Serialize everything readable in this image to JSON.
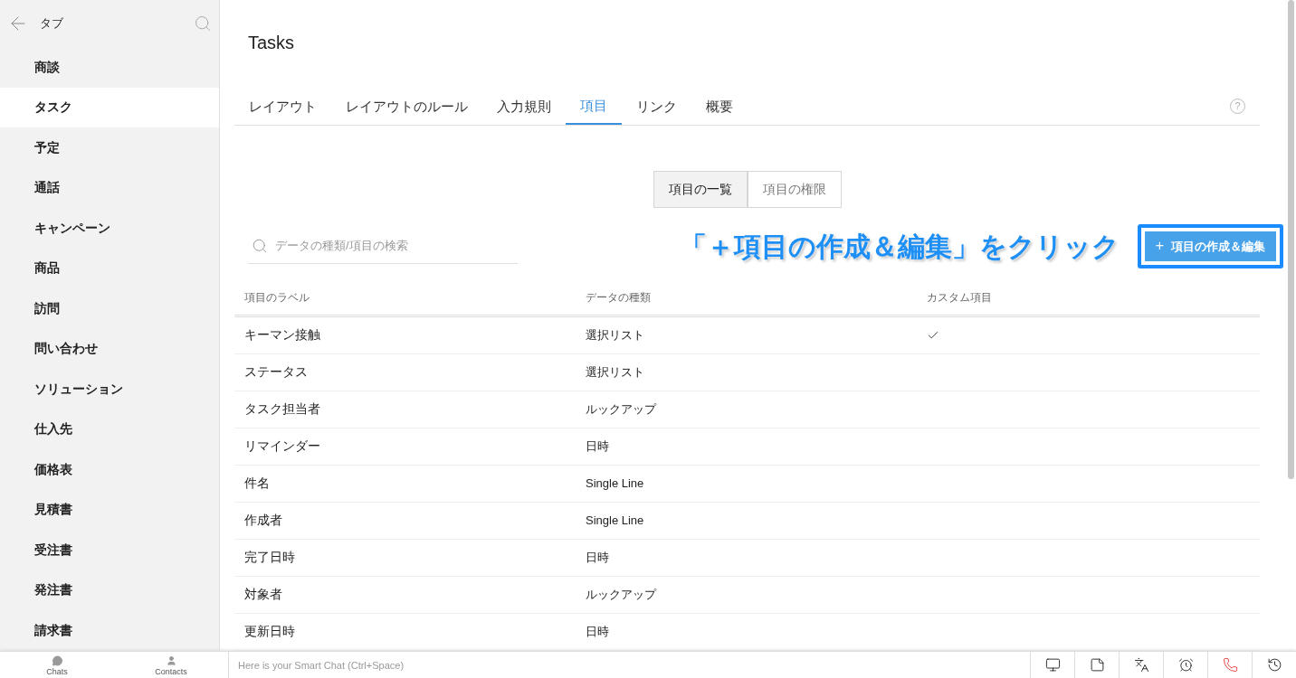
{
  "sidebar": {
    "title": "タブ",
    "items": [
      {
        "label": "商談",
        "selected": false
      },
      {
        "label": "タスク",
        "selected": true
      },
      {
        "label": "予定",
        "selected": false
      },
      {
        "label": "通話",
        "selected": false
      },
      {
        "label": "キャンペーン",
        "selected": false
      },
      {
        "label": "商品",
        "selected": false
      },
      {
        "label": "訪問",
        "selected": false
      },
      {
        "label": "問い合わせ",
        "selected": false
      },
      {
        "label": "ソリューション",
        "selected": false
      },
      {
        "label": "仕入先",
        "selected": false
      },
      {
        "label": "価格表",
        "selected": false
      },
      {
        "label": "見積書",
        "selected": false
      },
      {
        "label": "受注書",
        "selected": false
      },
      {
        "label": "発注書",
        "selected": false
      },
      {
        "label": "請求書",
        "selected": false
      }
    ]
  },
  "page": {
    "title": "Tasks"
  },
  "tabs": [
    {
      "label": "レイアウト",
      "selected": false
    },
    {
      "label": "レイアウトのルール",
      "selected": false
    },
    {
      "label": "入力規則",
      "selected": false
    },
    {
      "label": "項目",
      "selected": true
    },
    {
      "label": "リンク",
      "selected": false
    },
    {
      "label": "概要",
      "selected": false
    }
  ],
  "help": "?",
  "view_toggle": [
    {
      "label": "項目の一覧",
      "selected": true
    },
    {
      "label": "項目の権限",
      "selected": false
    }
  ],
  "search": {
    "placeholder": "データの種類/項目の検索"
  },
  "annotation": "「＋項目の作成＆編集」をクリック",
  "create_button": {
    "icon": "+",
    "label": "項目の作成＆編集"
  },
  "table": {
    "columns": [
      "項目のラベル",
      "データの種類",
      "カスタム項目"
    ],
    "rows": [
      {
        "label": "キーマン接触",
        "type": "選択リスト",
        "custom": true
      },
      {
        "label": "ステータス",
        "type": "選択リスト",
        "custom": false
      },
      {
        "label": "タスク担当者",
        "type": "ルックアップ",
        "custom": false
      },
      {
        "label": "リマインダー",
        "type": "日時",
        "custom": false
      },
      {
        "label": "件名",
        "type": "Single Line",
        "custom": false
      },
      {
        "label": "作成者",
        "type": "Single Line",
        "custom": false
      },
      {
        "label": "完了日時",
        "type": "日時",
        "custom": false
      },
      {
        "label": "対象者",
        "type": "ルックアップ",
        "custom": false
      },
      {
        "label": "更新日時",
        "type": "日時",
        "custom": false
      }
    ]
  },
  "bottom_bar": {
    "chats": "Chats",
    "contacts": "Contacts",
    "smart_chat_placeholder": "Here is your Smart Chat (Ctrl+Space)"
  }
}
